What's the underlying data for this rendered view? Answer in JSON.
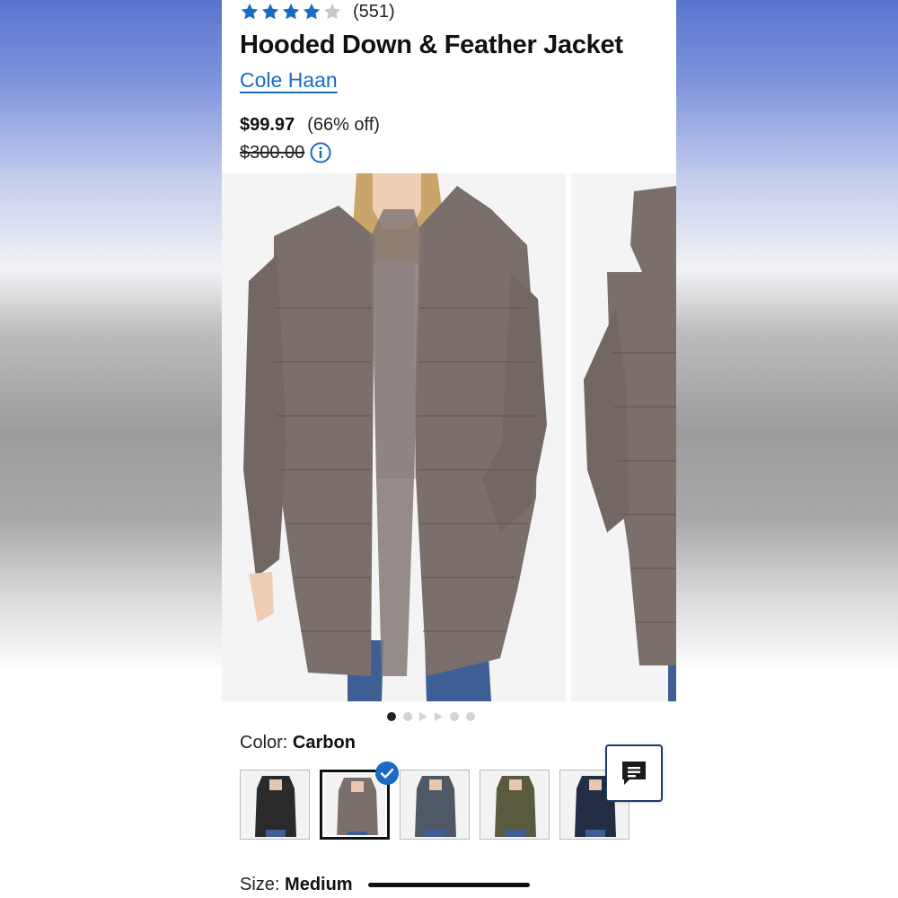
{
  "product": {
    "rating_count": "(551)",
    "rating_value": 4.5,
    "title": "Hooded Down & Feather Jacket",
    "brand": "Cole Haan",
    "price": "$99.97",
    "discount": "(66% off)",
    "original_price": "$300.00"
  },
  "gallery": {
    "image_count": 6,
    "active_index": 0
  },
  "color": {
    "label": "Color: ",
    "value": "Carbon",
    "swatches": [
      "black",
      "carbon",
      "slate",
      "olive",
      "navy"
    ],
    "selected": "carbon"
  },
  "size": {
    "label": "Size: ",
    "value": "Medium"
  },
  "colors": {
    "accent": "#1a6bc4",
    "star": "#1a6bc4",
    "jacket": "#7a6e6a"
  }
}
